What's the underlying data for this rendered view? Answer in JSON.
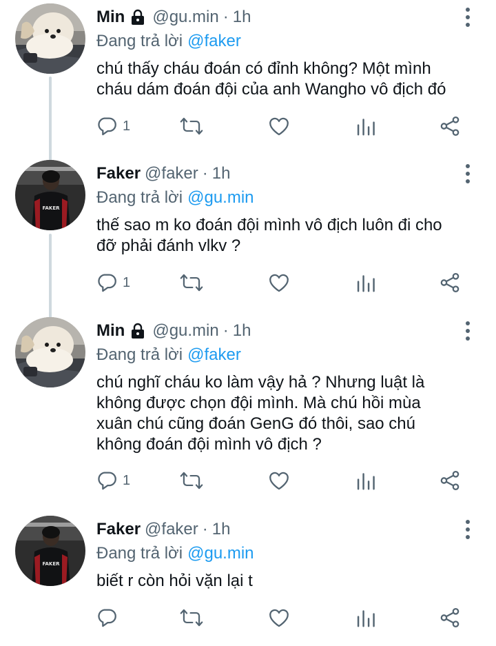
{
  "tweets": [
    {
      "name": "Min",
      "protected": true,
      "handle": "@gu.min",
      "separator": "·",
      "time": "1h",
      "reply_prefix": "Đang trả lời",
      "reply_to": "@faker",
      "text_lines": [
        "chú thấy cháu đoán có đỉnh không? Một mình",
        "cháu dám đoán đội của anh Wangho vô địch đó"
      ],
      "reply_count": "1",
      "avatar": "dog-avatar"
    },
    {
      "name": "Faker",
      "protected": false,
      "handle": "@faker",
      "separator": "·",
      "time": "1h",
      "reply_prefix": "Đang trả lời",
      "reply_to": "@gu.min",
      "text_lines": [
        "thế sao m ko đoán đội mình vô địch luôn đi cho",
        "đỡ phải đánh vlkv ?"
      ],
      "reply_count": "1",
      "avatar": "player-avatar",
      "jersey_text": "FAKER"
    },
    {
      "name": "Min",
      "protected": true,
      "handle": "@gu.min",
      "separator": "·",
      "time": "1h",
      "reply_prefix": "Đang trả lời",
      "reply_to": "@faker",
      "text_lines": [
        "chú nghĩ cháu ko làm vậy hả ? Nhưng luật là",
        "không được chọn đội mình. Mà chú hồi mùa",
        "xuân chú cũng đoán GenG đó thôi, sao chú",
        "không đoán đội mình vô địch ?"
      ],
      "reply_count": "1",
      "avatar": "dog-avatar"
    },
    {
      "name": "Faker",
      "protected": false,
      "handle": "@faker",
      "separator": "·",
      "time": "1h",
      "reply_prefix": "Đang trả lời",
      "reply_to": "@gu.min",
      "text_lines": [
        "biết r còn hỏi vặn lại t"
      ],
      "reply_count": "",
      "avatar": "player-avatar",
      "jersey_text": "FAKER"
    }
  ],
  "icons": {
    "reply": "reply-icon",
    "retweet": "retweet-icon",
    "like": "like-icon",
    "analytics": "analytics-icon",
    "share": "share-icon",
    "more": "more-icon",
    "lock": "lock-icon"
  },
  "colors": {
    "text": "#0f1419",
    "secondary": "#536471",
    "link": "#1d9bf0",
    "thread_line": "#cfd9de"
  }
}
